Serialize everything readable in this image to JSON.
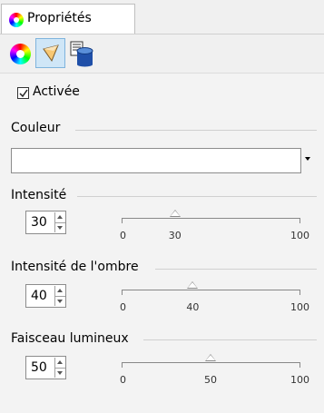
{
  "tab": {
    "label": "Propriétés",
    "icon": "color-wheel-icon"
  },
  "toolbar": {
    "buttons": [
      {
        "name": "color-wheel-icon",
        "active": false
      },
      {
        "name": "spotlight-icon",
        "active": true
      },
      {
        "name": "database-icon",
        "active": false
      }
    ]
  },
  "enabled": {
    "label": "Activée",
    "checked": true
  },
  "color": {
    "label": "Couleur",
    "value": "#ffffff"
  },
  "intensity": {
    "label": "Intensité",
    "value": "30",
    "min": "0",
    "mid": "30",
    "max": "100",
    "fraction": 0.3
  },
  "shadow": {
    "label": "Intensité de l'ombre",
    "value": "40",
    "min": "0",
    "mid": "40",
    "max": "100",
    "fraction": 0.4
  },
  "beam": {
    "label": "Faisceau lumineux",
    "value": "50",
    "min": "0",
    "mid": "50",
    "max": "100",
    "fraction": 0.5
  }
}
